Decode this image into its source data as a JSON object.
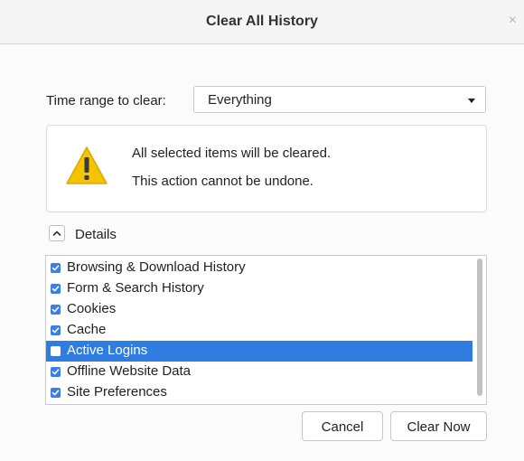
{
  "window": {
    "title": "Clear All History",
    "close_glyph": "×"
  },
  "time_range": {
    "label": "Time range to clear:",
    "selected": "Everything"
  },
  "warning": {
    "icon": "warning-icon",
    "line1": "All selected items will be cleared.",
    "line2": "This action cannot be undone."
  },
  "details": {
    "label": "Details",
    "expanded": true
  },
  "items": [
    {
      "label": "Browsing & Download History",
      "checked": true,
      "selected": false
    },
    {
      "label": "Form & Search History",
      "checked": true,
      "selected": false
    },
    {
      "label": "Cookies",
      "checked": true,
      "selected": false
    },
    {
      "label": "Cache",
      "checked": true,
      "selected": false
    },
    {
      "label": "Active Logins",
      "checked": false,
      "selected": true
    },
    {
      "label": "Offline Website Data",
      "checked": true,
      "selected": false
    },
    {
      "label": "Site Preferences",
      "checked": true,
      "selected": false
    }
  ],
  "buttons": {
    "cancel": "Cancel",
    "clear_now": "Clear Now"
  },
  "colors": {
    "accent": "#2f7de1",
    "checkbox": "#3a7ee8",
    "warning_yellow": "#f5c400"
  }
}
